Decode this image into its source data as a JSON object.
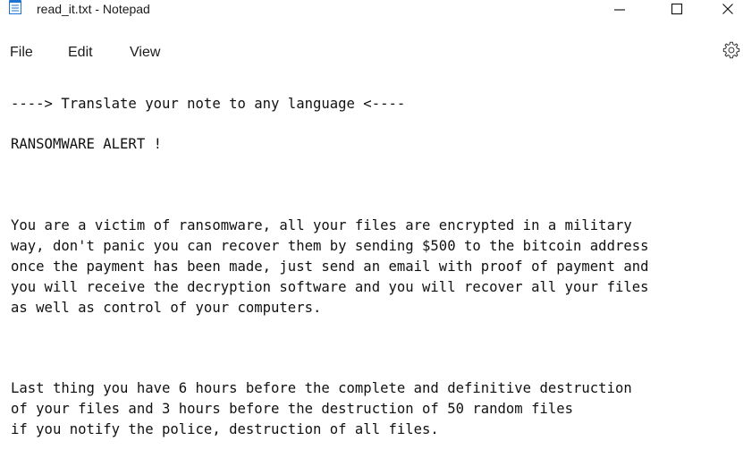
{
  "window": {
    "title": "read_it.txt - Notepad",
    "icons": {
      "app": "notepad-icon",
      "minimize": "minimize-icon",
      "maximize": "maximize-icon",
      "close": "close-icon",
      "settings": "gear-icon"
    }
  },
  "menu": {
    "file": "File",
    "edit": "Edit",
    "view": "View"
  },
  "document": {
    "lines": [
      "----> Translate your note to any language <----",
      "RANSOMWARE ALERT !",
      "You are a victim of ransomware, all your files are encrypted in a military",
      "way, don't panic you can recover them by sending $500 to the bitcoin address",
      "once the payment has been made, just send an email with proof of payment and",
      "you will receive the decryption software and you will recover all your files",
      "as well as control of your computers.",
      "Last thing you have 6 hours before the complete and definitive destruction",
      "of your files and 3 hours before the destruction of 50 random files",
      "if you notify the police, destruction of all files."
    ]
  },
  "colors": {
    "background": "#ffffff",
    "text": "#111111",
    "icon_blue": "#1e73d2"
  }
}
